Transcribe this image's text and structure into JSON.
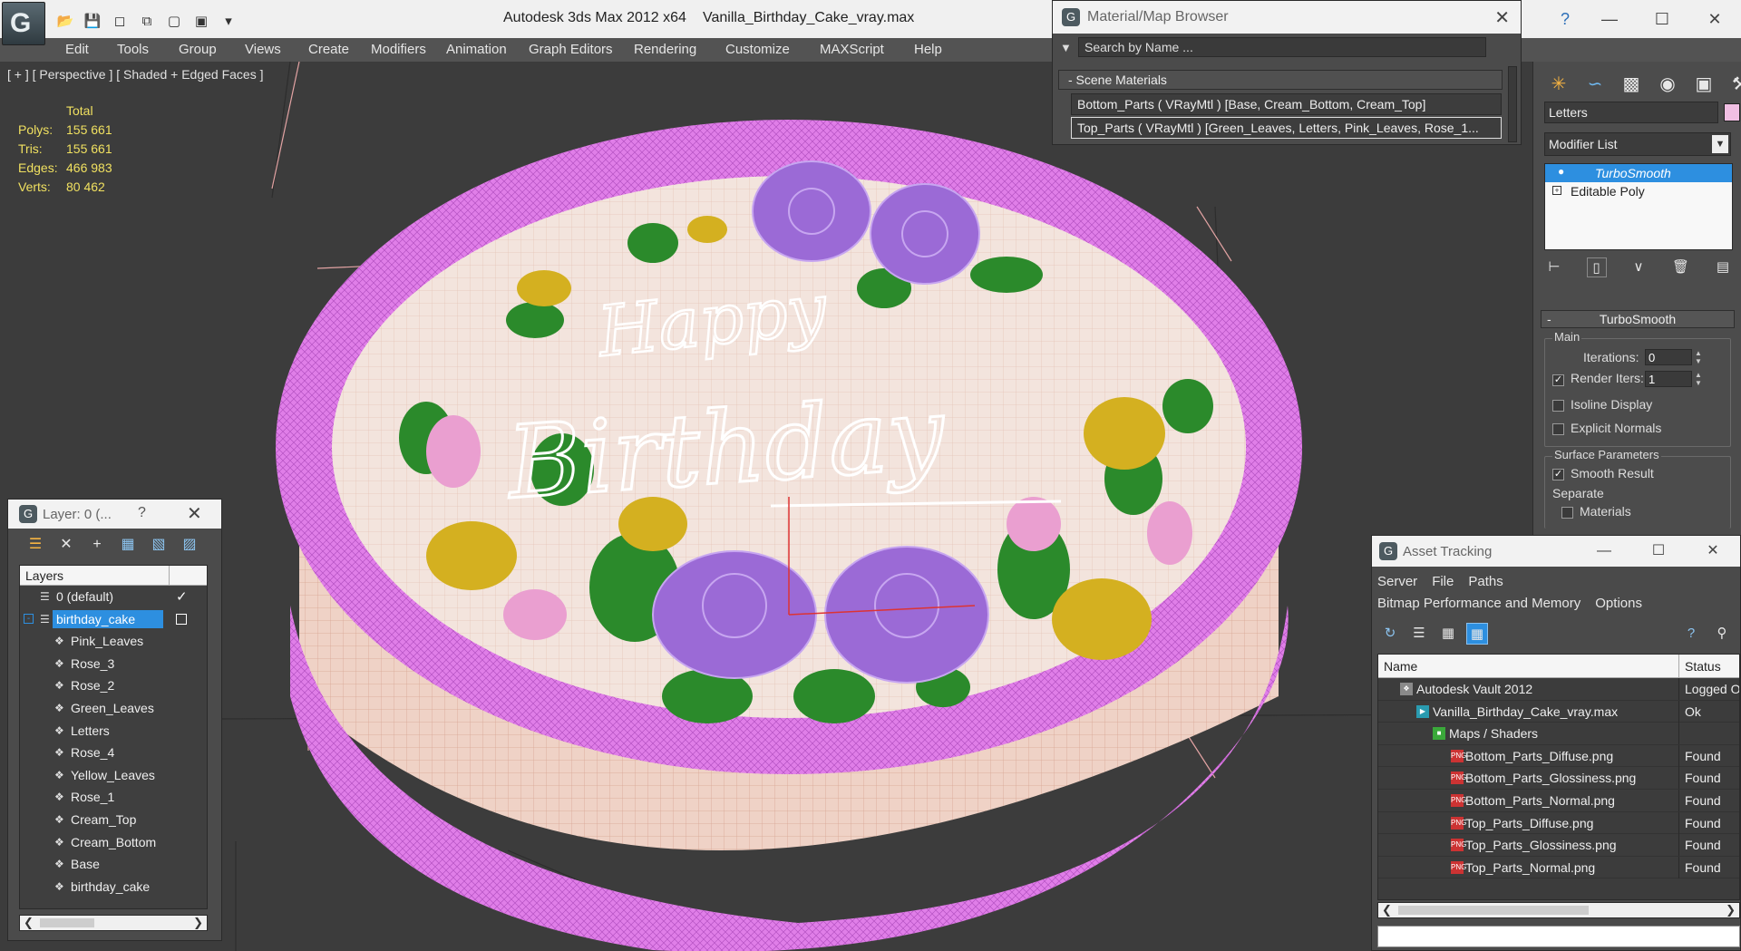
{
  "titlebar": {
    "app_title": "Autodesk 3ds Max  2012 x64",
    "file_title": "Vanilla_Birthday_Cake_vray.max",
    "qa_icons": [
      "open-icon",
      "save-icon",
      "new-scene-icon",
      "hold-icon",
      "fetch-icon",
      "window-icon",
      "dropdown-icon"
    ],
    "help_icon": "help-icon"
  },
  "menu": [
    "Edit",
    "Tools",
    "Group",
    "Views",
    "Create",
    "Modifiers",
    "Animation",
    "Graph Editors",
    "Rendering",
    "Customize",
    "MAXScript",
    "Help"
  ],
  "viewport": {
    "label": "[ + ] [ Perspective ] [ Shaded + Edged Faces ]",
    "stats": {
      "header": "Total",
      "rows": [
        {
          "k": "Polys:",
          "v": "155 661"
        },
        {
          "k": "Tris:",
          "v": "155 661"
        },
        {
          "k": "Edges:",
          "v": "466 983"
        },
        {
          "k": "Verts:",
          "v": "80 462"
        }
      ]
    },
    "text_top": "Happy",
    "text_main": "Birthday",
    "colors": {
      "bg": "#3c3c3c",
      "frosting": "#e07ee8",
      "cake": "#f3d9cf",
      "wire": "#e3b8a8",
      "leaf": "#2b8a2b",
      "yellow": "#d4b020",
      "rose": "#9b6ad6"
    }
  },
  "material_browser": {
    "title": "Material/Map Browser",
    "search_placeholder": "Search by Name ...",
    "section": "- Scene Materials",
    "rows": [
      "Bottom_Parts  ( VRayMtl )  [Base, Cream_Bottom, Cream_Top]",
      "Top_Parts  ( VRayMtl )  [Green_Leaves, Letters, Pink_Leaves, Rose_1..."
    ]
  },
  "command_panel": {
    "object_name": "Letters",
    "object_color": "#f1bfe3",
    "modifier_list": "Modifier List",
    "stack": [
      {
        "label": "TurboSmooth",
        "active": true
      },
      {
        "label": "Editable Poly",
        "active": false
      }
    ],
    "rollout_title": "TurboSmooth",
    "main_group": "Main",
    "iterations_label": "Iterations:",
    "iterations_value": "0",
    "render_iters_label": "Render Iters:",
    "render_iters_value": "1",
    "render_iters_checked": true,
    "isoline_label": "Isoline Display",
    "explicit_normals_label": "Explicit Normals",
    "surface_group": "Surface Parameters",
    "smooth_result_label": "Smooth Result",
    "smooth_result_checked": true,
    "separate_label": "Separate",
    "materials_label": "Materials"
  },
  "layer_panel": {
    "title": "Layer: 0 (...",
    "help": "?",
    "header": "Layers",
    "rows": [
      {
        "name": "0 (default)",
        "indent": 1,
        "checked": true
      },
      {
        "name": "birthday_cake",
        "indent": 1,
        "selected": true
      },
      {
        "name": "Pink_Leaves",
        "indent": 2
      },
      {
        "name": "Rose_3",
        "indent": 2
      },
      {
        "name": "Rose_2",
        "indent": 2
      },
      {
        "name": "Green_Leaves",
        "indent": 2
      },
      {
        "name": "Letters",
        "indent": 2
      },
      {
        "name": "Rose_4",
        "indent": 2
      },
      {
        "name": "Yellow_Leaves",
        "indent": 2
      },
      {
        "name": "Rose_1",
        "indent": 2
      },
      {
        "name": "Cream_Top",
        "indent": 2
      },
      {
        "name": "Cream_Bottom",
        "indent": 2
      },
      {
        "name": "Base",
        "indent": 2
      },
      {
        "name": "birthday_cake",
        "indent": 2
      }
    ]
  },
  "asset_tracking": {
    "title": "Asset Tracking",
    "menu1": [
      "Server",
      "File",
      "Paths"
    ],
    "menu2": [
      "Bitmap Performance and Memory",
      "Options"
    ],
    "col_name": "Name",
    "col_status": "Status",
    "rows": [
      {
        "name": "Autodesk Vault 2012",
        "status": "Logged O",
        "indent": 0,
        "icon": "vault-icon"
      },
      {
        "name": "Vanilla_Birthday_Cake_vray.max",
        "status": "Ok",
        "indent": 1,
        "icon": "max-file-icon"
      },
      {
        "name": "Maps / Shaders",
        "status": "",
        "indent": 2,
        "icon": "maps-icon"
      },
      {
        "name": "Bottom_Parts_Diffuse.png",
        "status": "Found",
        "indent": 3,
        "icon": "png-icon"
      },
      {
        "name": "Bottom_Parts_Glossiness.png",
        "status": "Found",
        "indent": 3,
        "icon": "png-icon"
      },
      {
        "name": "Bottom_Parts_Normal.png",
        "status": "Found",
        "indent": 3,
        "icon": "png-icon"
      },
      {
        "name": "Top_Parts_Diffuse.png",
        "status": "Found",
        "indent": 3,
        "icon": "png-icon"
      },
      {
        "name": "Top_Parts_Glossiness.png",
        "status": "Found",
        "indent": 3,
        "icon": "png-icon"
      },
      {
        "name": "Top_Parts_Normal.png",
        "status": "Found",
        "indent": 3,
        "icon": "png-icon"
      }
    ]
  }
}
